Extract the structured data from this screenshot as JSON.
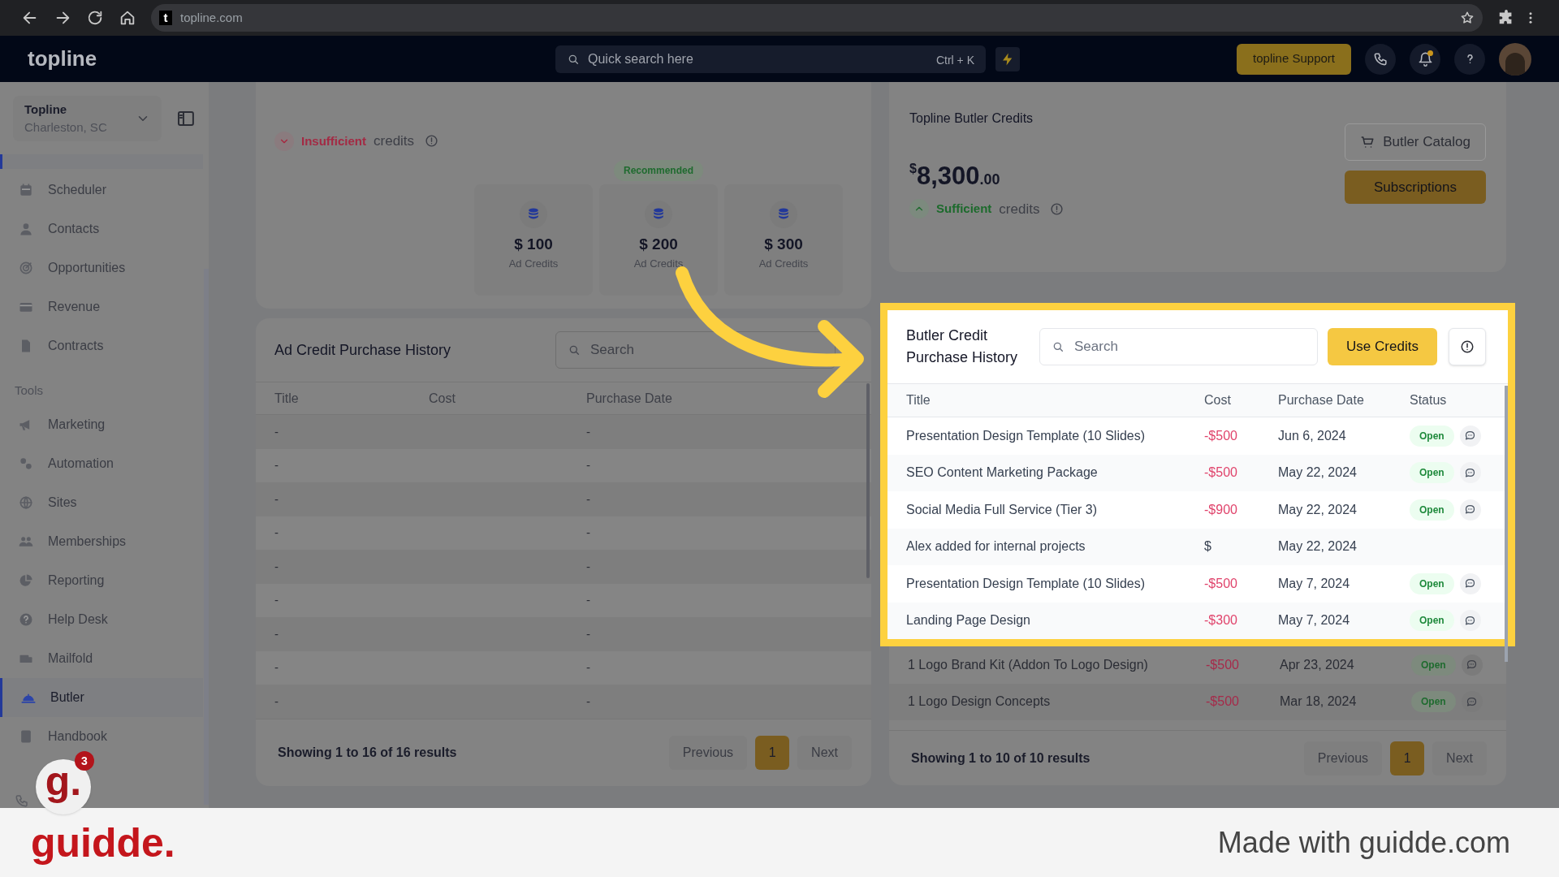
{
  "browser": {
    "favicon": "t",
    "url": "topline.com"
  },
  "topbar": {
    "logo": "topline",
    "search_placeholder": "Quick search here",
    "shortcut": "Ctrl + K",
    "support_button": "topline Support",
    "notification_dot": true
  },
  "sidebar": {
    "account": {
      "name": "Topline",
      "location": "Charleston, SC"
    },
    "groups": [
      {
        "items": [
          {
            "label": "Scheduler",
            "selected": false
          },
          {
            "label": "Contacts",
            "selected": false
          },
          {
            "label": "Opportunities",
            "selected": false
          },
          {
            "label": "Revenue",
            "selected": false
          },
          {
            "label": "Contracts",
            "selected": false
          }
        ]
      },
      {
        "heading": "Tools",
        "items": [
          {
            "label": "Marketing",
            "selected": false
          },
          {
            "label": "Automation",
            "selected": false
          },
          {
            "label": "Sites",
            "selected": false
          },
          {
            "label": "Memberships",
            "selected": false
          },
          {
            "label": "Reporting",
            "selected": false
          },
          {
            "label": "Help Desk",
            "selected": false
          },
          {
            "label": "Mailfold",
            "selected": false
          },
          {
            "label": "Butler",
            "selected": true
          },
          {
            "label": "Handbook",
            "selected": false
          }
        ]
      }
    ]
  },
  "ad_credits": {
    "status_label": "Insufficient",
    "status_suffix": "credits",
    "packages": [
      {
        "amount": "$ 100",
        "label": "Ad Credits"
      },
      {
        "amount": "$ 200",
        "label": "Ad Credits",
        "badge": "Recommended"
      },
      {
        "amount": "$ 300",
        "label": "Ad Credits"
      }
    ]
  },
  "butler_credits": {
    "title": "Topline Butler Credits",
    "currency": "$",
    "amount": "8,300",
    "cents": ".00",
    "status_label": "Sufficient",
    "status_suffix": "credits",
    "catalog_button": "Butler Catalog",
    "subscriptions_button": "Subscriptions"
  },
  "ad_history": {
    "title": "Ad Credit Purchase History",
    "search_placeholder": "Search",
    "columns": [
      "Title",
      "Cost",
      "Purchase Date"
    ],
    "rows": [
      {
        "title": "-",
        "purchase_date": "-"
      },
      {
        "title": "-",
        "purchase_date": "-"
      },
      {
        "title": "-",
        "purchase_date": "-"
      },
      {
        "title": "-",
        "purchase_date": "-"
      },
      {
        "title": "-",
        "purchase_date": "-"
      },
      {
        "title": "-",
        "purchase_date": "-"
      },
      {
        "title": "-",
        "purchase_date": "-"
      },
      {
        "title": "-",
        "purchase_date": "-"
      },
      {
        "title": "-",
        "purchase_date": "-"
      }
    ],
    "summary": "Showing 1 to 16 of 16 results",
    "pagination": {
      "previous": "Previous",
      "pages": [
        {
          "label": "1",
          "selected": true
        }
      ],
      "next": "Next"
    }
  },
  "butler_history": {
    "title": "Butler Credit Purchase History",
    "search_placeholder": "Search",
    "action_button": "Use Credits",
    "columns": [
      "Title",
      "Cost",
      "Purchase Date",
      "Status"
    ],
    "rows": [
      {
        "title": "Presentation Design Template (10 Slides)",
        "cost": "-$500",
        "purchase_date": "Jun 6, 2024",
        "status": "Open",
        "highlighted": true
      },
      {
        "title": "SEO Content Marketing Package",
        "cost": "-$500",
        "purchase_date": "May 22, 2024",
        "status": "Open",
        "highlighted": true
      },
      {
        "title": "Social Media Full Service (Tier 3)",
        "cost": "-$900",
        "purchase_date": "May 22, 2024",
        "status": "Open",
        "highlighted": true
      },
      {
        "title": "Alex added for internal projects",
        "cost": "$",
        "purchase_date": "May 22, 2024",
        "highlighted": true
      },
      {
        "title": "Presentation Design Template (10 Slides)",
        "cost": "-$500",
        "purchase_date": "May 7, 2024",
        "status": "Open",
        "highlighted": true
      },
      {
        "title": "Landing Page Design",
        "cost": "-$300",
        "purchase_date": "May 7, 2024",
        "status": "Open",
        "highlighted": true
      },
      {
        "title": "1 Logo Brand Kit (Addon To Logo Design)",
        "cost": "-$500",
        "purchase_date": "Apr 23, 2024",
        "status": "Open",
        "highlighted": false
      },
      {
        "title": "1 Logo Design Concepts",
        "cost": "-$500",
        "purchase_date": "Mar 18, 2024",
        "status": "Open",
        "highlighted": false
      }
    ],
    "summary": "Showing 1 to 10 of 10 results",
    "pagination": {
      "previous": "Previous",
      "pages": [
        {
          "label": "1",
          "selected": true
        }
      ],
      "next": "Next"
    }
  },
  "guidde_badge": {
    "letter": "g.",
    "count": "3"
  },
  "footer_banner": {
    "logo": "guidde.",
    "text": "Made with guidde.com"
  }
}
